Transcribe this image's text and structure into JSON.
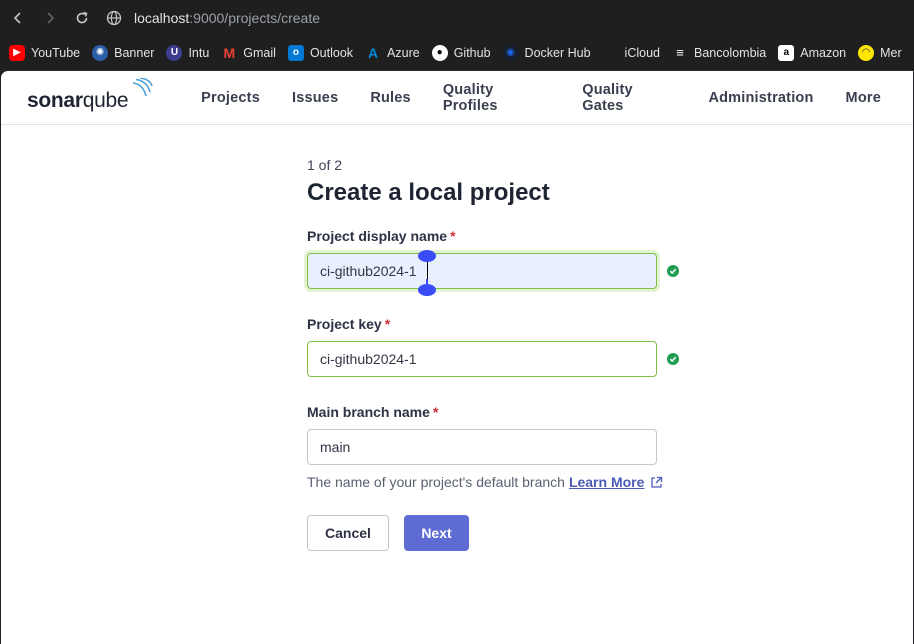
{
  "browser": {
    "url_host": "localhost",
    "url_path": ":9000/projects/create",
    "bookmarks": [
      {
        "label": "YouTube",
        "icon": "youtube-icon",
        "color": "#ff0000"
      },
      {
        "label": "Banner",
        "icon": "banner-icon",
        "color": "#2d5fa8"
      },
      {
        "label": "Intu",
        "icon": "intu-icon",
        "color": "#3d3d8f"
      },
      {
        "label": "Gmail",
        "icon": "gmail-icon",
        "color": "#ea4335"
      },
      {
        "label": "Outlook",
        "icon": "outlook-icon",
        "color": "#0078d4"
      },
      {
        "label": "Azure",
        "icon": "azure-icon",
        "color": "#0089d6"
      },
      {
        "label": "Github",
        "icon": "github-icon",
        "color": "#ffffff"
      },
      {
        "label": "Docker Hub",
        "icon": "docker-icon",
        "color": "#1d63ed"
      },
      {
        "label": "iCloud",
        "icon": "apple-icon",
        "color": "#ffffff"
      },
      {
        "label": "Bancolombia",
        "icon": "bancolombia-icon",
        "color": "#ffffff"
      },
      {
        "label": "Amazon",
        "icon": "amazon-icon",
        "color": "#ffffff"
      },
      {
        "label": "Mer",
        "icon": "mercadolibre-icon",
        "color": "#ffe600"
      }
    ]
  },
  "app": {
    "logo_bold": "sonar",
    "logo_light": "qube",
    "nav": [
      "Projects",
      "Issues",
      "Rules",
      "Quality Profiles",
      "Quality Gates",
      "Administration",
      "More"
    ]
  },
  "form": {
    "step": "1 of 2",
    "title": "Create a local project",
    "required_mark": "*",
    "display_name": {
      "label": "Project display name",
      "value": "ci-github2024-1"
    },
    "project_key": {
      "label": "Project key",
      "value": "ci-github2024-1"
    },
    "branch": {
      "label": "Main branch name",
      "value": "main"
    },
    "helper_text": "The name of your project's default branch",
    "learn_more": "Learn More",
    "cancel_label": "Cancel",
    "next_label": "Next"
  },
  "colors": {
    "primary": "#5d6bd2",
    "valid": "#1f9d55",
    "required": "#d02f3a"
  }
}
